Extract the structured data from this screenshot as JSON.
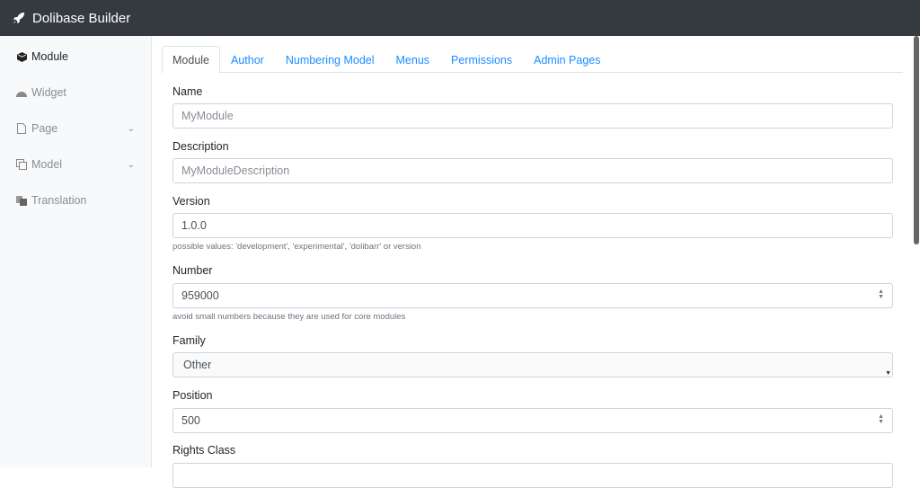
{
  "app": {
    "title": "Dolibase Builder",
    "icon": "rocket-icon"
  },
  "sidebar": {
    "items": [
      {
        "label": "Module",
        "icon": "cube-icon"
      },
      {
        "label": "Widget",
        "icon": "dashboard-icon"
      },
      {
        "label": "Page",
        "icon": "file-icon"
      },
      {
        "label": "Model",
        "icon": "copy-icon"
      },
      {
        "label": "Translation",
        "icon": "language-icon"
      }
    ]
  },
  "tabs": [
    "Module",
    "Author",
    "Numbering Model",
    "Menus",
    "Permissions",
    "Admin Pages"
  ],
  "form": {
    "name": {
      "label": "Name",
      "placeholder": "MyModule"
    },
    "description": {
      "label": "Description",
      "placeholder": "MyModuleDescription"
    },
    "version": {
      "label": "Version",
      "value": "1.0.0",
      "help": "possible values: 'development', 'experimental', 'dolibarr' or version"
    },
    "number": {
      "label": "Number",
      "value": "959000",
      "help": "avoid small numbers because they are used for core modules"
    },
    "family": {
      "label": "Family",
      "value": "Other"
    },
    "position": {
      "label": "Position",
      "value": "500"
    },
    "rights_class": {
      "label": "Rights Class"
    }
  }
}
